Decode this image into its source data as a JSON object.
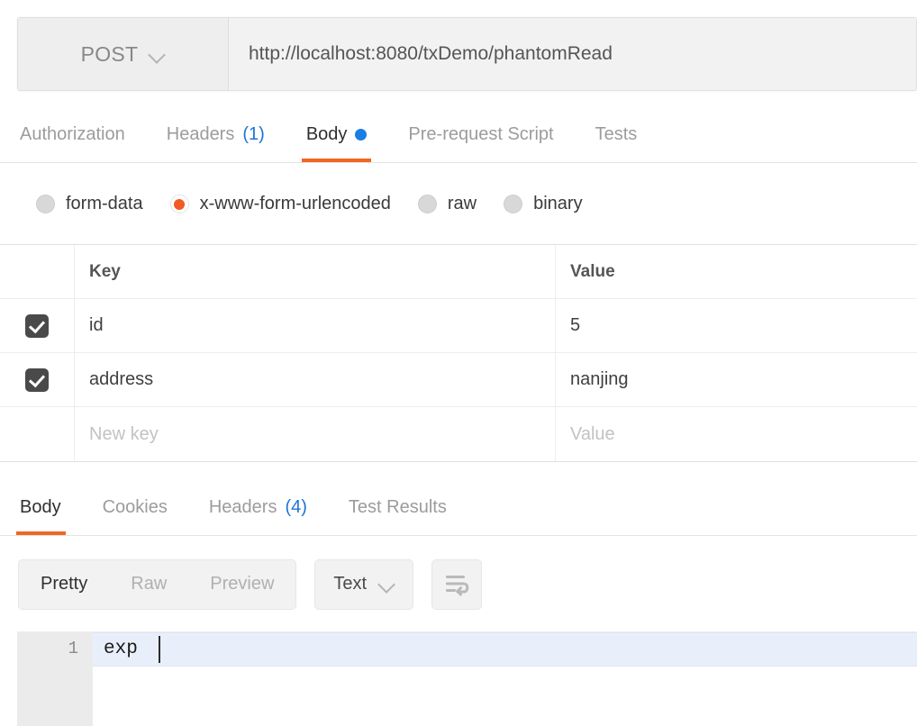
{
  "request": {
    "method": "POST",
    "method_caret_icon": "chevron-down-icon",
    "url": "http://localhost:8080/txDemo/phantomRead",
    "url_placeholder": "Enter request URL"
  },
  "request_tabs": [
    {
      "label": "Authorization",
      "count": "",
      "active": false,
      "dot": false
    },
    {
      "label": "Headers",
      "count": "(1)",
      "active": false,
      "dot": false
    },
    {
      "label": "Body",
      "count": "",
      "active": true,
      "dot": true
    },
    {
      "label": "Pre-request Script",
      "count": "",
      "active": false,
      "dot": false
    },
    {
      "label": "Tests",
      "count": "",
      "active": false,
      "dot": false
    }
  ],
  "body_types": [
    {
      "label": "form-data",
      "checked": false
    },
    {
      "label": "x-www-form-urlencoded",
      "checked": true
    },
    {
      "label": "raw",
      "checked": false
    },
    {
      "label": "binary",
      "checked": false
    }
  ],
  "kv_table": {
    "headers": {
      "key": "Key",
      "value": "Value"
    },
    "rows": [
      {
        "checked": true,
        "key": "id",
        "value": "5",
        "placeholder": false
      },
      {
        "checked": true,
        "key": "address",
        "value": "nanjing",
        "placeholder": false
      },
      {
        "checked": false,
        "key": "New key",
        "value": "Value",
        "placeholder": true
      }
    ]
  },
  "response_tabs": [
    {
      "label": "Body",
      "count": "",
      "active": true
    },
    {
      "label": "Cookies",
      "count": "",
      "active": false
    },
    {
      "label": "Headers",
      "count": "(4)",
      "active": false
    },
    {
      "label": "Test Results",
      "count": "",
      "active": false
    }
  ],
  "response_toolbar": {
    "view_modes": [
      {
        "label": "Pretty",
        "active": true
      },
      {
        "label": "Raw",
        "active": false
      },
      {
        "label": "Preview",
        "active": false
      }
    ],
    "format_selected": "Text",
    "format_caret_icon": "chevron-down-icon",
    "wrap_button_icon": "word-wrap-icon"
  },
  "editor": {
    "line_number": "1",
    "line_content": "exp"
  },
  "colors": {
    "accent_orange": "#f06623",
    "radio_orange": "#f15a22",
    "link_blue": "#1d76d2",
    "dot_blue": "#1a7ee5",
    "checkbox_dark": "#4a4a4a",
    "active_line": "#e9effa"
  }
}
